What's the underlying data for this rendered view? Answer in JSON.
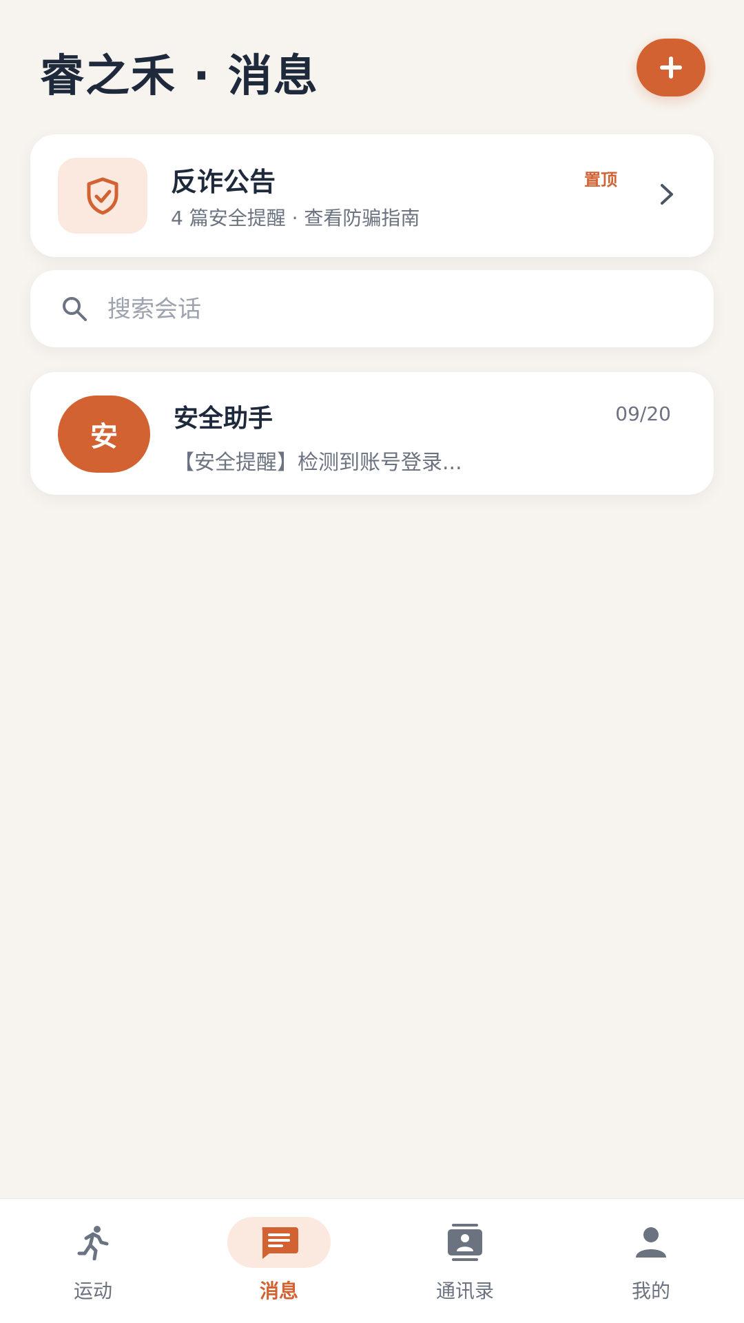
{
  "header": {
    "title": "睿之禾 · 消息",
    "add_icon": "plus-icon"
  },
  "notice": {
    "icon": "shield-check-icon",
    "title": "反诈公告",
    "subtitle": "4 篇安全提醒 · 查看防骗指南",
    "pin_label": "置顶"
  },
  "search": {
    "placeholder": "搜索会话",
    "icon": "search-icon"
  },
  "conversations": [
    {
      "avatar_text": "安",
      "name": "安全助手",
      "time": "09/20",
      "preview": "【安全提醒】检测到账号登录..."
    }
  ],
  "bottom_nav": [
    {
      "label": "运动",
      "icon": "run-icon"
    },
    {
      "label": "消息",
      "icon": "message-icon",
      "active": true
    },
    {
      "label": "通讯录",
      "icon": "contacts-icon"
    },
    {
      "label": "我的",
      "icon": "person-icon"
    }
  ],
  "colors": {
    "accent": "#D36232",
    "accent_soft": "#FBE9DF",
    "background": "#F7F4EF"
  }
}
